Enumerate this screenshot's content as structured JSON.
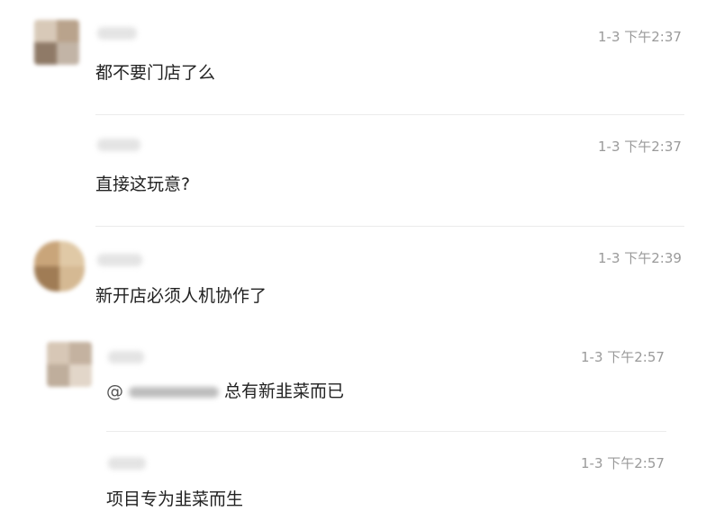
{
  "comments": [
    {
      "time": "1-3 下午2:37",
      "text": "都不要门店了么"
    },
    {
      "time": "1-3 下午2:37",
      "text": "直接这玩意?"
    },
    {
      "time": "1-3 下午2:39",
      "text": "新开店必须人机协作了"
    },
    {
      "time": "1-3 下午2:57",
      "at": "@",
      "text": "总有新韭菜而已"
    },
    {
      "time": "1-3 下午2:57",
      "text": "项目专为韭菜而生"
    }
  ]
}
